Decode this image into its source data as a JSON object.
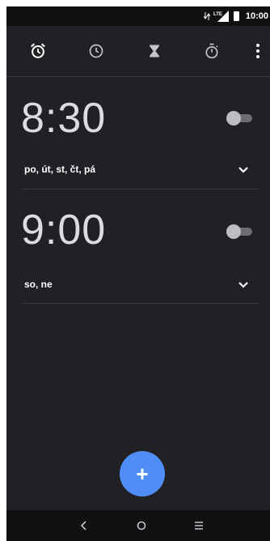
{
  "status_bar": {
    "time": "10:00",
    "network": "LTE",
    "icons": [
      "data-arrows-icon",
      "lte-signal-icon",
      "battery-icon"
    ]
  },
  "tabs": [
    {
      "name": "alarm",
      "icon": "alarm-clock-icon",
      "selected": true
    },
    {
      "name": "clock",
      "icon": "clock-icon",
      "selected": false
    },
    {
      "name": "timer",
      "icon": "hourglass-icon",
      "selected": false
    },
    {
      "name": "stopwatch",
      "icon": "stopwatch-icon",
      "selected": false
    }
  ],
  "overflow_menu_icon": "more-vert-icon",
  "alarms": [
    {
      "time": "8:30",
      "days": "po, út, st, čt, pá",
      "enabled": false
    },
    {
      "time": "9:00",
      "days": "so, ne",
      "enabled": false
    }
  ],
  "fab": {
    "label": "+",
    "icon": "add-icon"
  },
  "nav_bar": {
    "icons": [
      "back-icon",
      "home-icon",
      "recents-icon"
    ]
  },
  "colors": {
    "background": "#202124",
    "accent": "#4f8ef7",
    "text": "#dadce0"
  }
}
